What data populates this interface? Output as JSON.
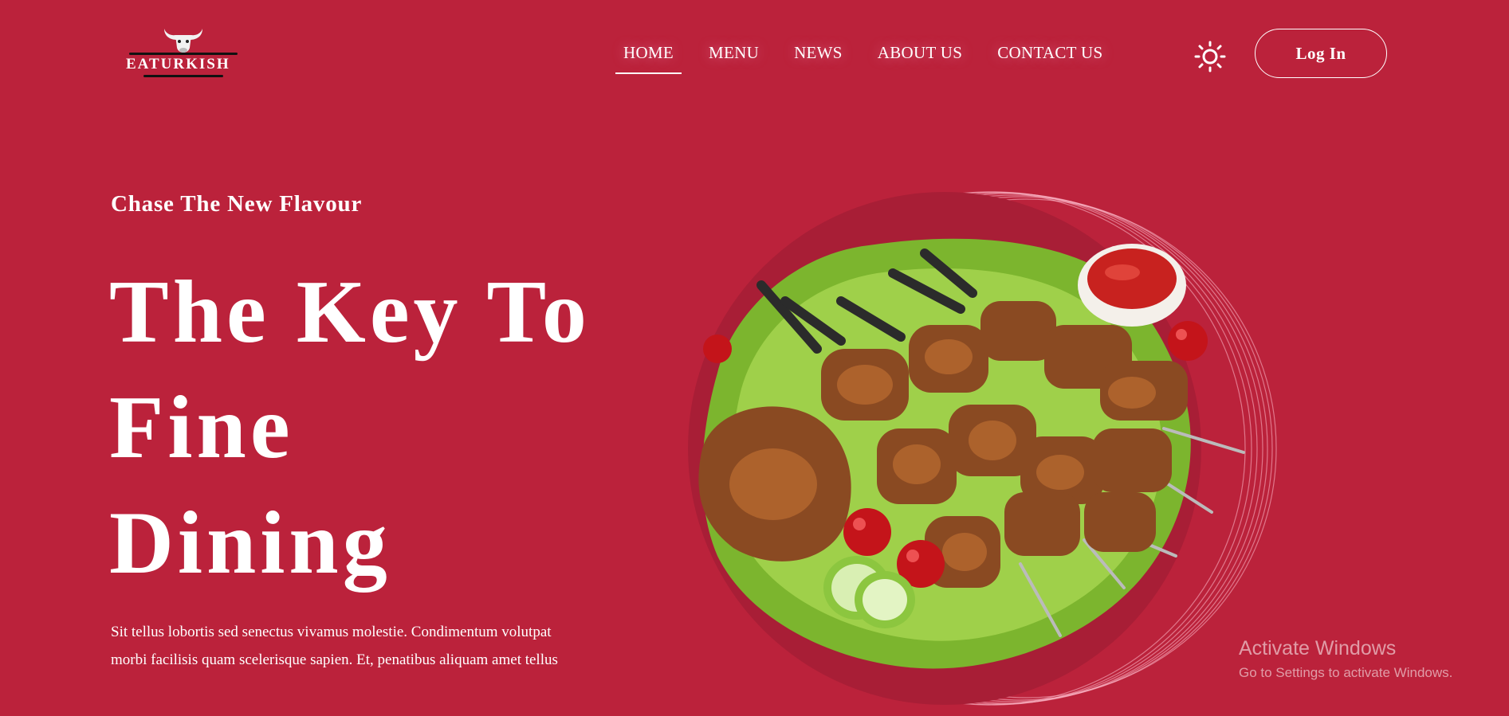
{
  "brand": {
    "name": "EATURKISH"
  },
  "nav": {
    "items": [
      {
        "label": "HOME",
        "active": true
      },
      {
        "label": "MENU",
        "active": false
      },
      {
        "label": "NEWS",
        "active": false
      },
      {
        "label": "ABOUT US",
        "active": false
      },
      {
        "label": "CONTACT US",
        "active": false
      }
    ],
    "theme_icon": "sun-icon",
    "login_label": "Log In"
  },
  "hero": {
    "tagline": "Chase The New Flavour",
    "title_lines": [
      "The Key To",
      "Fine",
      "Dining"
    ],
    "description": "Sit tellus lobortis sed senectus vivamus molestie. Condimentum volutpat morbi facilisis quam scelerisque sapien. Et, penatibus aliquam amet tellus",
    "image": "grilled-meat-platter"
  },
  "watermark": {
    "title": "Activate Windows",
    "subtitle": "Go to Settings to activate Windows."
  },
  "colors": {
    "background": "#bb223b",
    "text": "#ffffff",
    "plate": "#a81e36"
  }
}
